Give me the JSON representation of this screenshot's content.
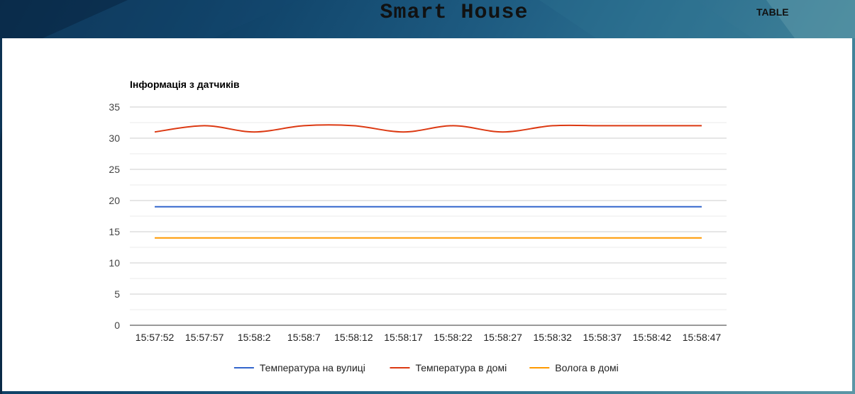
{
  "header": {
    "title": "Smart House",
    "nav_table": "TABLE"
  },
  "chart_data": {
    "type": "line",
    "title": "Інформація з датчиків",
    "xlabel": "",
    "ylabel": "",
    "ylim": [
      0,
      35
    ],
    "yticks": [
      0,
      5,
      10,
      15,
      20,
      25,
      30,
      35
    ],
    "grid": true,
    "legend_position": "bottom",
    "categories": [
      "15:57:52",
      "15:57:57",
      "15:58:2",
      "15:58:7",
      "15:58:12",
      "15:58:17",
      "15:58:22",
      "15:58:27",
      "15:58:32",
      "15:58:37",
      "15:58:42",
      "15:58:47"
    ],
    "series": [
      {
        "name": "Температура на вулиці",
        "color": "#3366cc",
        "values": [
          19,
          19,
          19,
          19,
          19,
          19,
          19,
          19,
          19,
          19,
          19,
          19
        ]
      },
      {
        "name": "Температура в домі",
        "color": "#dc3912",
        "values": [
          31,
          32,
          31,
          32,
          32,
          31,
          32,
          31,
          32,
          32,
          32,
          32
        ]
      },
      {
        "name": "Волога в домі",
        "color": "#ff9900",
        "values": [
          14,
          14,
          14,
          14,
          14,
          14,
          14,
          14,
          14,
          14,
          14,
          14
        ]
      }
    ]
  }
}
